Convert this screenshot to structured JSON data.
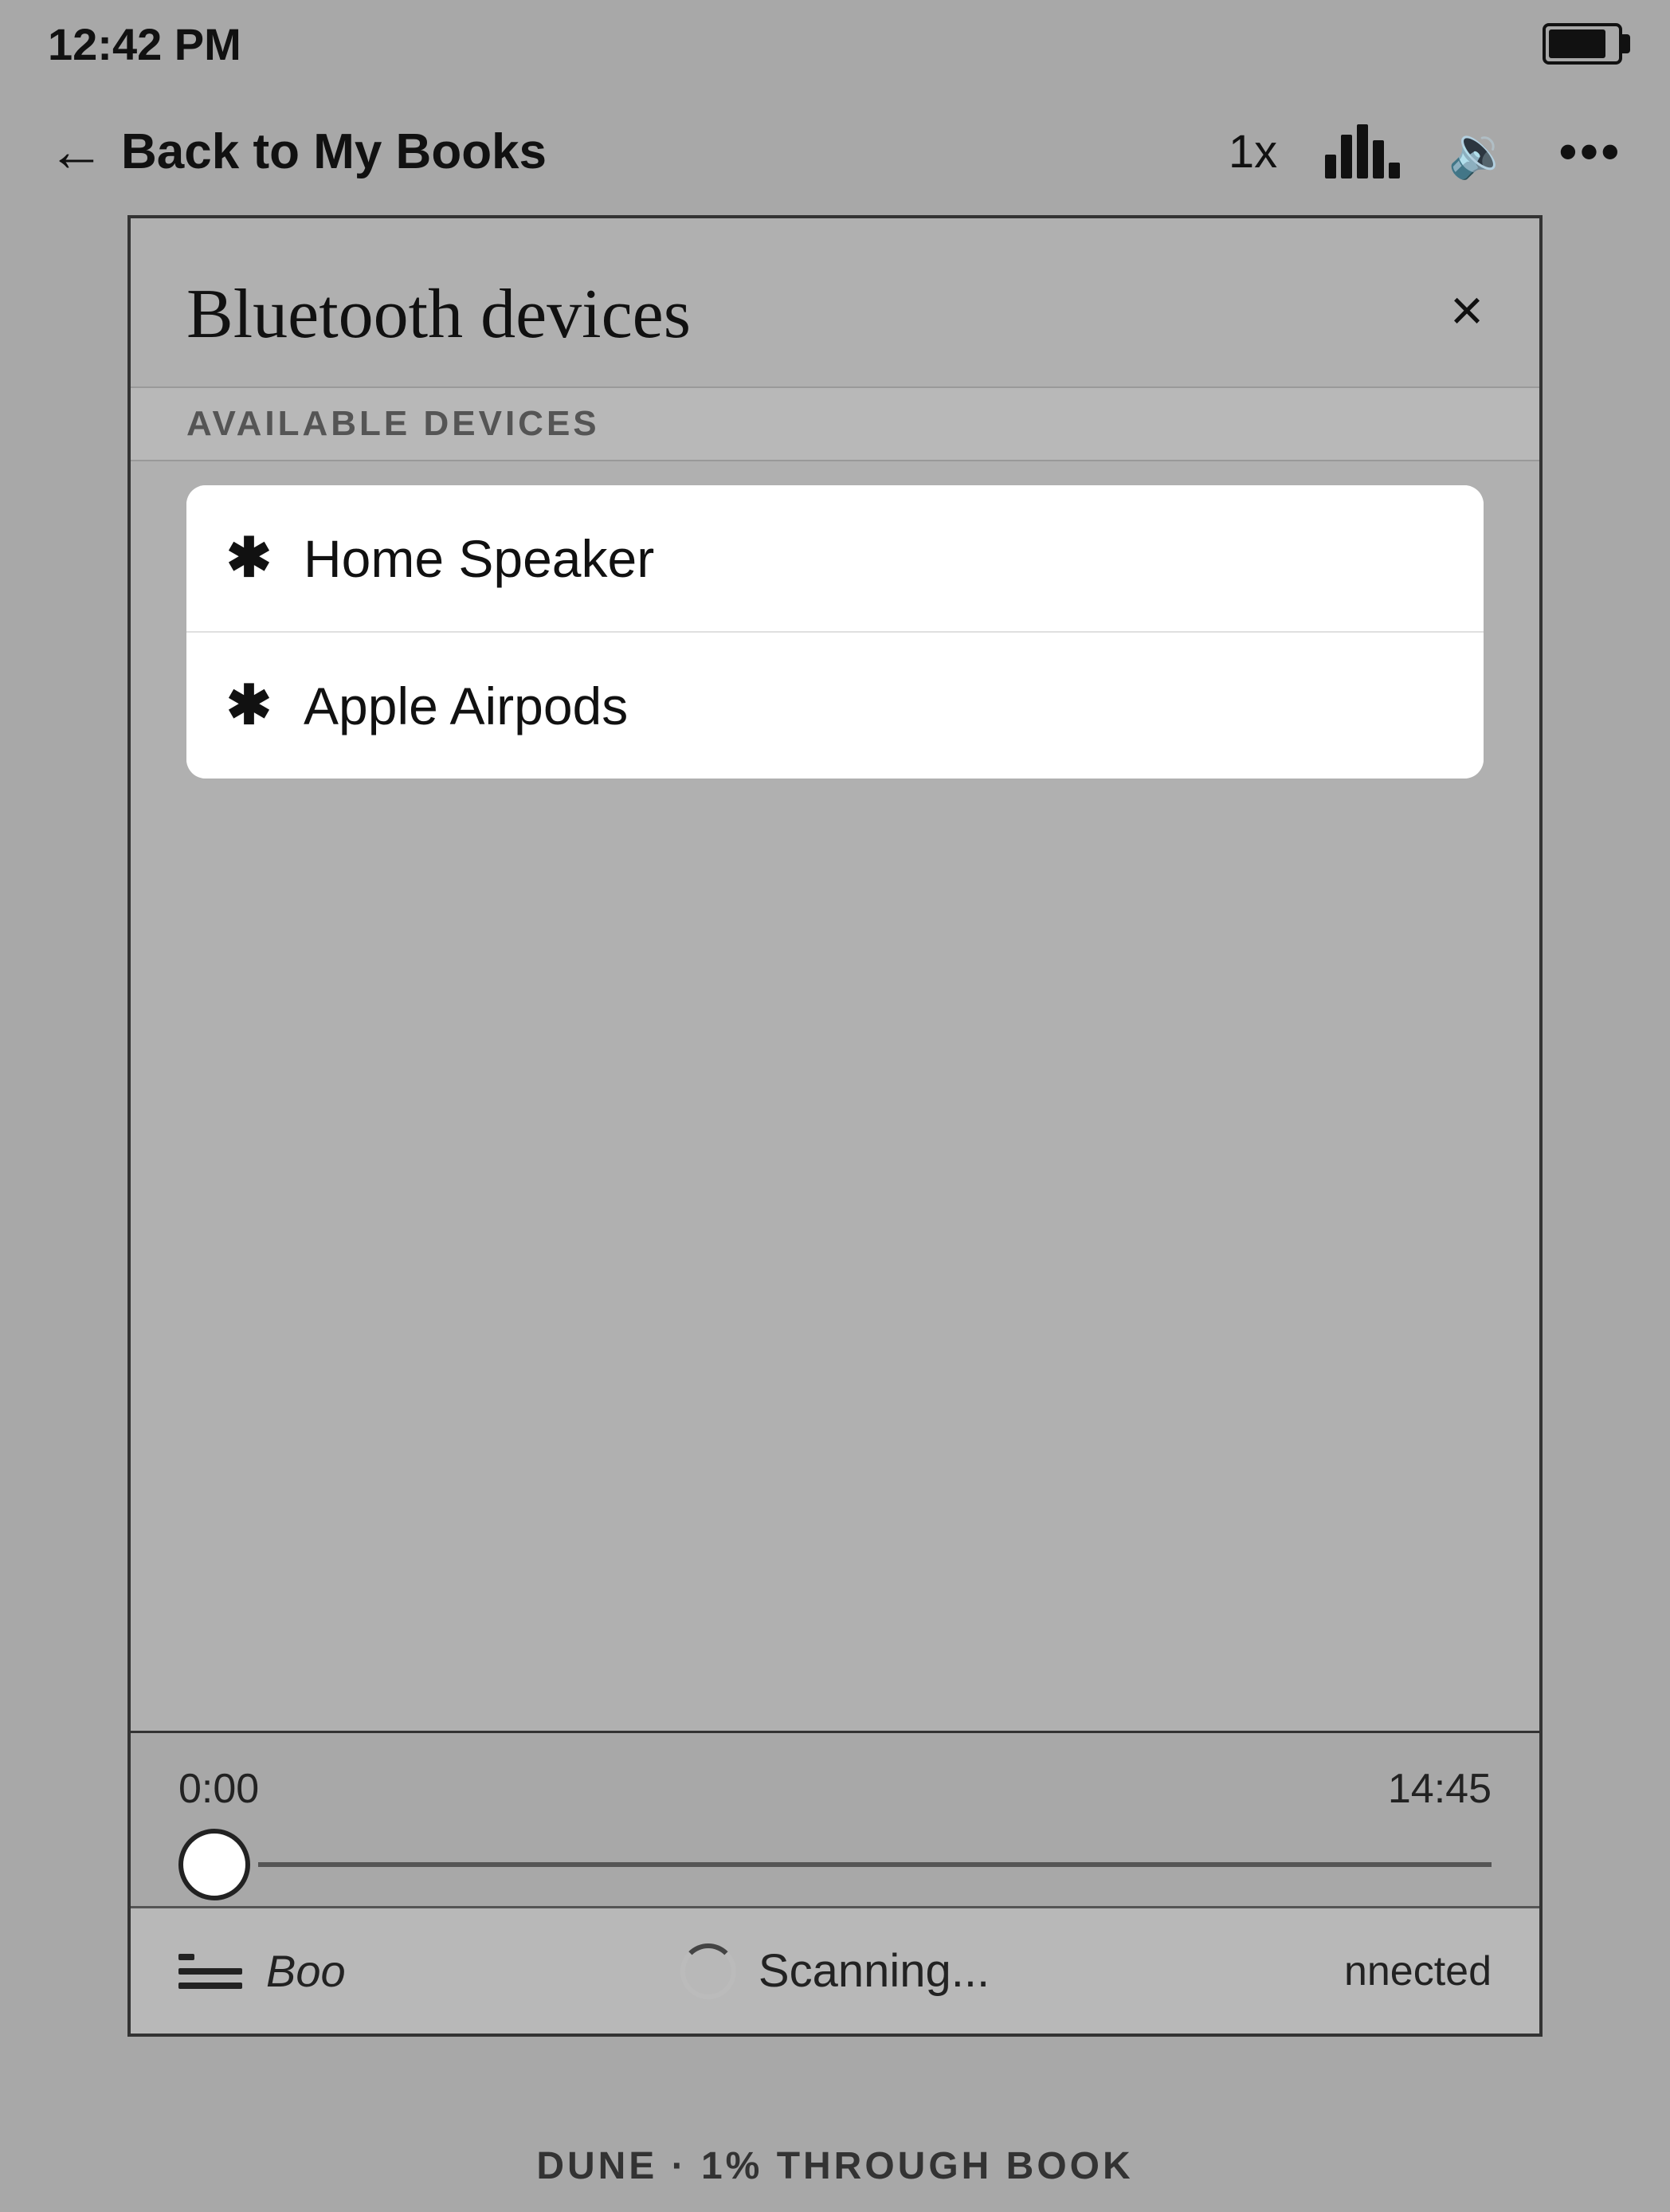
{
  "status_bar": {
    "time": "12:42 PM"
  },
  "nav": {
    "back_label": "Back to My Books",
    "speed": "1x",
    "more": "•••"
  },
  "dialog": {
    "title": "Bluetooth devices",
    "close": "×",
    "section_label": "AVAILABLE DEVICES",
    "devices": [
      {
        "name": "Home Speaker"
      },
      {
        "name": "Apple Airpods"
      }
    ]
  },
  "player": {
    "time_start": "0:00",
    "time_end": "14:45"
  },
  "bottom": {
    "list_icon_label": "Boo",
    "scanning_label": "Scanning...",
    "connected_label": "nnected"
  },
  "footer": {
    "text": "DUNE · 1% THROUGH BOOK"
  },
  "bars": [
    {
      "height": 30
    },
    {
      "height": 55
    },
    {
      "height": 68
    },
    {
      "height": 48
    },
    {
      "height": 20
    }
  ]
}
